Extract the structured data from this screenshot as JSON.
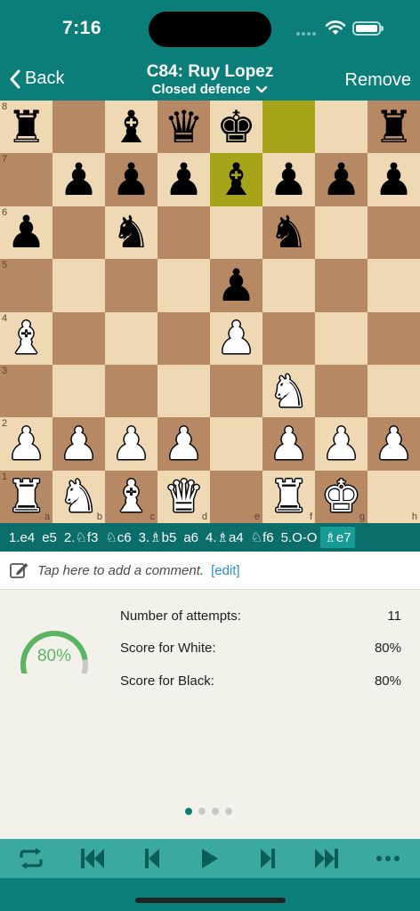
{
  "status_bar": {
    "time": "7:16"
  },
  "nav": {
    "back_label": "Back",
    "title": "C84: Ruy Lopez",
    "subtitle": "Closed defence",
    "remove_label": "Remove"
  },
  "board": {
    "files": [
      "a",
      "b",
      "c",
      "d",
      "e",
      "f",
      "g",
      "h"
    ],
    "ranks": [
      "8",
      "7",
      "6",
      "5",
      "4",
      "3",
      "2",
      "1"
    ],
    "highlight_squares": [
      "f8",
      "e7"
    ],
    "colors": {
      "light": "#efd9b4",
      "dark": "#b68863",
      "highlight": "#a6a51a"
    },
    "rows": [
      [
        "bR",
        "",
        "bB",
        "bQ",
        "bK",
        "",
        "",
        "bR"
      ],
      [
        "",
        "bP",
        "bP",
        "bP",
        "bB",
        "bP",
        "bP",
        "bP"
      ],
      [
        "bP",
        "",
        "bN",
        "",
        "",
        "bN",
        "",
        ""
      ],
      [
        "",
        "",
        "",
        "",
        "bP",
        "",
        "",
        ""
      ],
      [
        "wB",
        "",
        "",
        "",
        "wP",
        "",
        "",
        ""
      ],
      [
        "",
        "",
        "",
        "",
        "",
        "wN",
        "",
        ""
      ],
      [
        "wP",
        "wP",
        "wP",
        "wP",
        "",
        "wP",
        "wP",
        "wP"
      ],
      [
        "wR",
        "wN",
        "wB",
        "wQ",
        "",
        "wR",
        "wK",
        ""
      ]
    ]
  },
  "moves": [
    {
      "label": "1.e4"
    },
    {
      "label": "e5"
    },
    {
      "label": "2.♘f3"
    },
    {
      "label": "♘c6"
    },
    {
      "label": "3.♗b5"
    },
    {
      "label": "a6"
    },
    {
      "label": "4.♗a4"
    },
    {
      "label": "♘f6"
    },
    {
      "label": "5.O-O"
    },
    {
      "label": "♗e7",
      "current": true
    }
  ],
  "comment": {
    "placeholder": "Tap here to add a comment.",
    "edit_label": "[edit]"
  },
  "stats": {
    "gauge_value": "80%",
    "gauge_fraction": 0.8,
    "rows": [
      {
        "label": "Number of attempts:",
        "value": "11"
      },
      {
        "label": "Score for White:",
        "value": "80%"
      },
      {
        "label": "Score for Black:",
        "value": "80%"
      }
    ]
  },
  "pager": {
    "count": 4,
    "active": 0
  },
  "toolbar": {
    "buttons": [
      "flip-board-icon",
      "first-move-icon",
      "previous-move-icon",
      "play-icon",
      "next-move-icon",
      "last-move-icon",
      "more-icon"
    ]
  },
  "accent_color": "#0b7e7a",
  "gauge_color": "#5bb462"
}
